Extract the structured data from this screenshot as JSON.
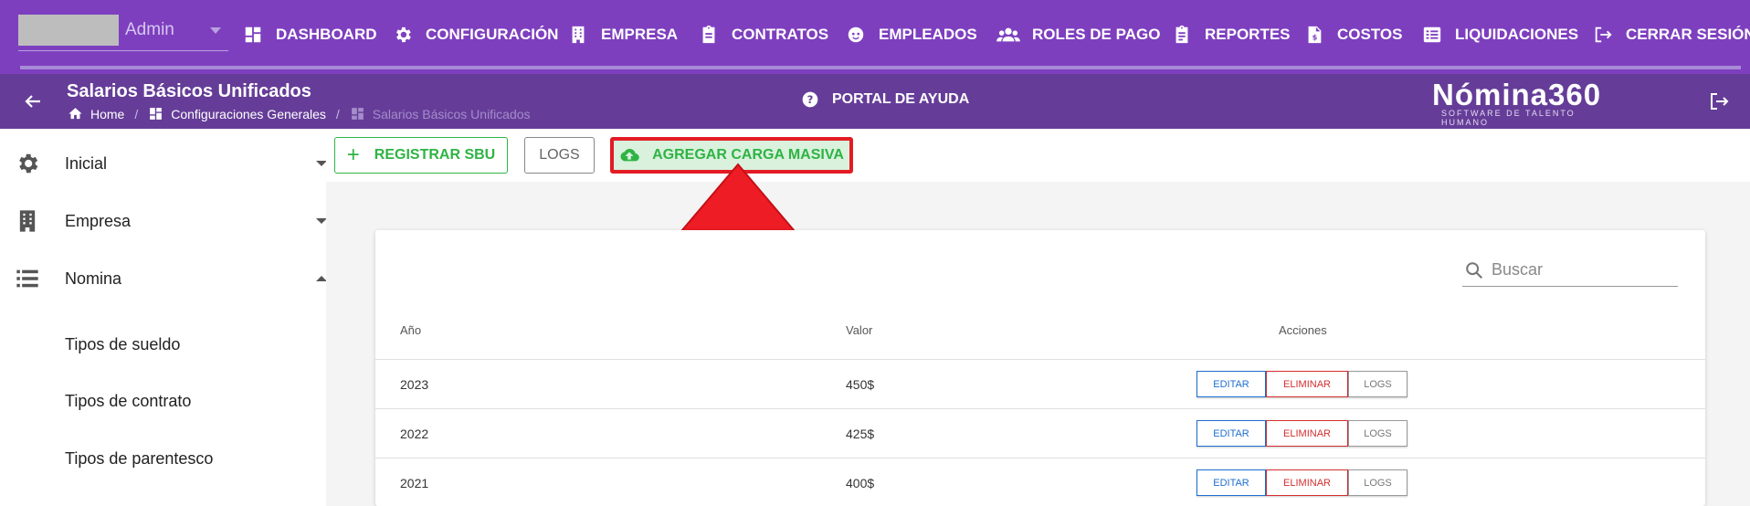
{
  "topnav": {
    "user_name": "Admin",
    "items": [
      {
        "label": "DASHBOARD",
        "icon": "dashboard-icon"
      },
      {
        "label": "CONFIGURACIÓN",
        "icon": "gear-icon"
      },
      {
        "label": "EMPRESA",
        "icon": "building-icon"
      },
      {
        "label": "CONTRATOS",
        "icon": "clipboard-icon"
      },
      {
        "label": "EMPLEADOS",
        "icon": "face-icon"
      },
      {
        "label": "ROLES DE PAGO",
        "icon": "users-icon"
      },
      {
        "label": "REPORTES",
        "icon": "clipboard-list-icon"
      },
      {
        "label": "COSTOS",
        "icon": "invoice-icon"
      },
      {
        "label": "LIQUIDACIONES",
        "icon": "list-icon"
      },
      {
        "label": "CERRAR SESIÓN",
        "icon": "logout-icon"
      }
    ]
  },
  "header": {
    "title": "Salarios Básicos Unificados",
    "breadcrumb": {
      "home": "Home",
      "config": "Configuraciones Generales",
      "current": "Salarios Básicos Unificados"
    },
    "help_label": "PORTAL DE AYUDA",
    "logo_main": "Nómina360",
    "logo_sub": "SOFTWARE DE TALENTO HUMANO"
  },
  "sidebar": {
    "items": [
      {
        "label": "Inicial",
        "icon": "gear-icon",
        "expanded": false
      },
      {
        "label": "Empresa",
        "icon": "building-icon",
        "expanded": false
      },
      {
        "label": "Nomina",
        "icon": "list-icon",
        "expanded": true
      }
    ],
    "subitems": [
      "Tipos de sueldo",
      "Tipos de contrato",
      "Tipos de parentesco"
    ]
  },
  "toolbar": {
    "register_label": "REGISTRAR SBU",
    "logs_label": "LOGS",
    "masiva_label": "AGREGAR CARGA MASIVA"
  },
  "table": {
    "search_placeholder": "Buscar",
    "columns": [
      "Año",
      "Valor",
      "Acciones"
    ],
    "rows": [
      {
        "year": "2023",
        "value": "450$"
      },
      {
        "year": "2022",
        "value": "425$"
      },
      {
        "year": "2021",
        "value": "400$"
      }
    ],
    "action_labels": {
      "edit": "EDITAR",
      "delete": "ELIMINAR",
      "logs": "LOGS"
    }
  },
  "colors": {
    "topnav_bg": "#7e3fbf",
    "header_bg": "#653d98",
    "success": "#2fb344",
    "highlight_red": "#e31b23"
  }
}
